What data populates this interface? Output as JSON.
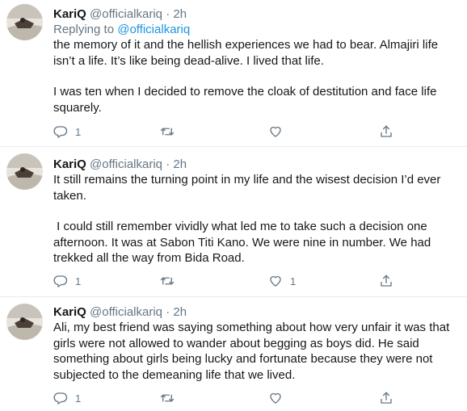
{
  "colors": {
    "text": "#14171a",
    "muted": "#657786",
    "link": "#1b95e0",
    "divider": "#e6ecf0"
  },
  "tweets": [
    {
      "name": "KariQ",
      "handle": "@officialkariq",
      "separator": "·",
      "time": "2h",
      "replying_prefix": "Replying to",
      "replying_to": "@officialkariq",
      "paragraphs": [
        "the memory of it and the hellish experiences we had to bear. Almajiri life isn’t a life. It’s like being dead-alive. I lived that life.",
        "I was ten when I decided to remove the cloak of destitution and face life squarely."
      ],
      "reply_count": "1",
      "retweet_count": "",
      "like_count": "",
      "icons": [
        "reply-icon",
        "retweet-icon",
        "like-icon",
        "share-icon"
      ]
    },
    {
      "name": "KariQ",
      "handle": "@officialkariq",
      "separator": "·",
      "time": "2h",
      "paragraphs": [
        "It still remains the turning point in my life and the wisest decision I’d ever taken.",
        " I could still remember vividly what led me to take such a decision one afternoon. It was at Sabon Titi Kano. We were nine in number. We had trekked all the way from Bida Road."
      ],
      "reply_count": "1",
      "retweet_count": "",
      "like_count": "1",
      "icons": [
        "reply-icon",
        "retweet-icon",
        "like-icon",
        "share-icon"
      ]
    },
    {
      "name": "KariQ",
      "handle": "@officialkariq",
      "separator": "·",
      "time": "2h",
      "paragraphs": [
        "Ali, my best friend was saying something about how very unfair it was that girls were not allowed to wander about begging as boys did. He said something about girls being lucky and fortunate because they were not subjected to the demeaning life that we lived."
      ],
      "reply_count": "1",
      "retweet_count": "",
      "like_count": "",
      "icons": [
        "reply-icon",
        "retweet-icon",
        "like-icon",
        "share-icon"
      ]
    }
  ]
}
